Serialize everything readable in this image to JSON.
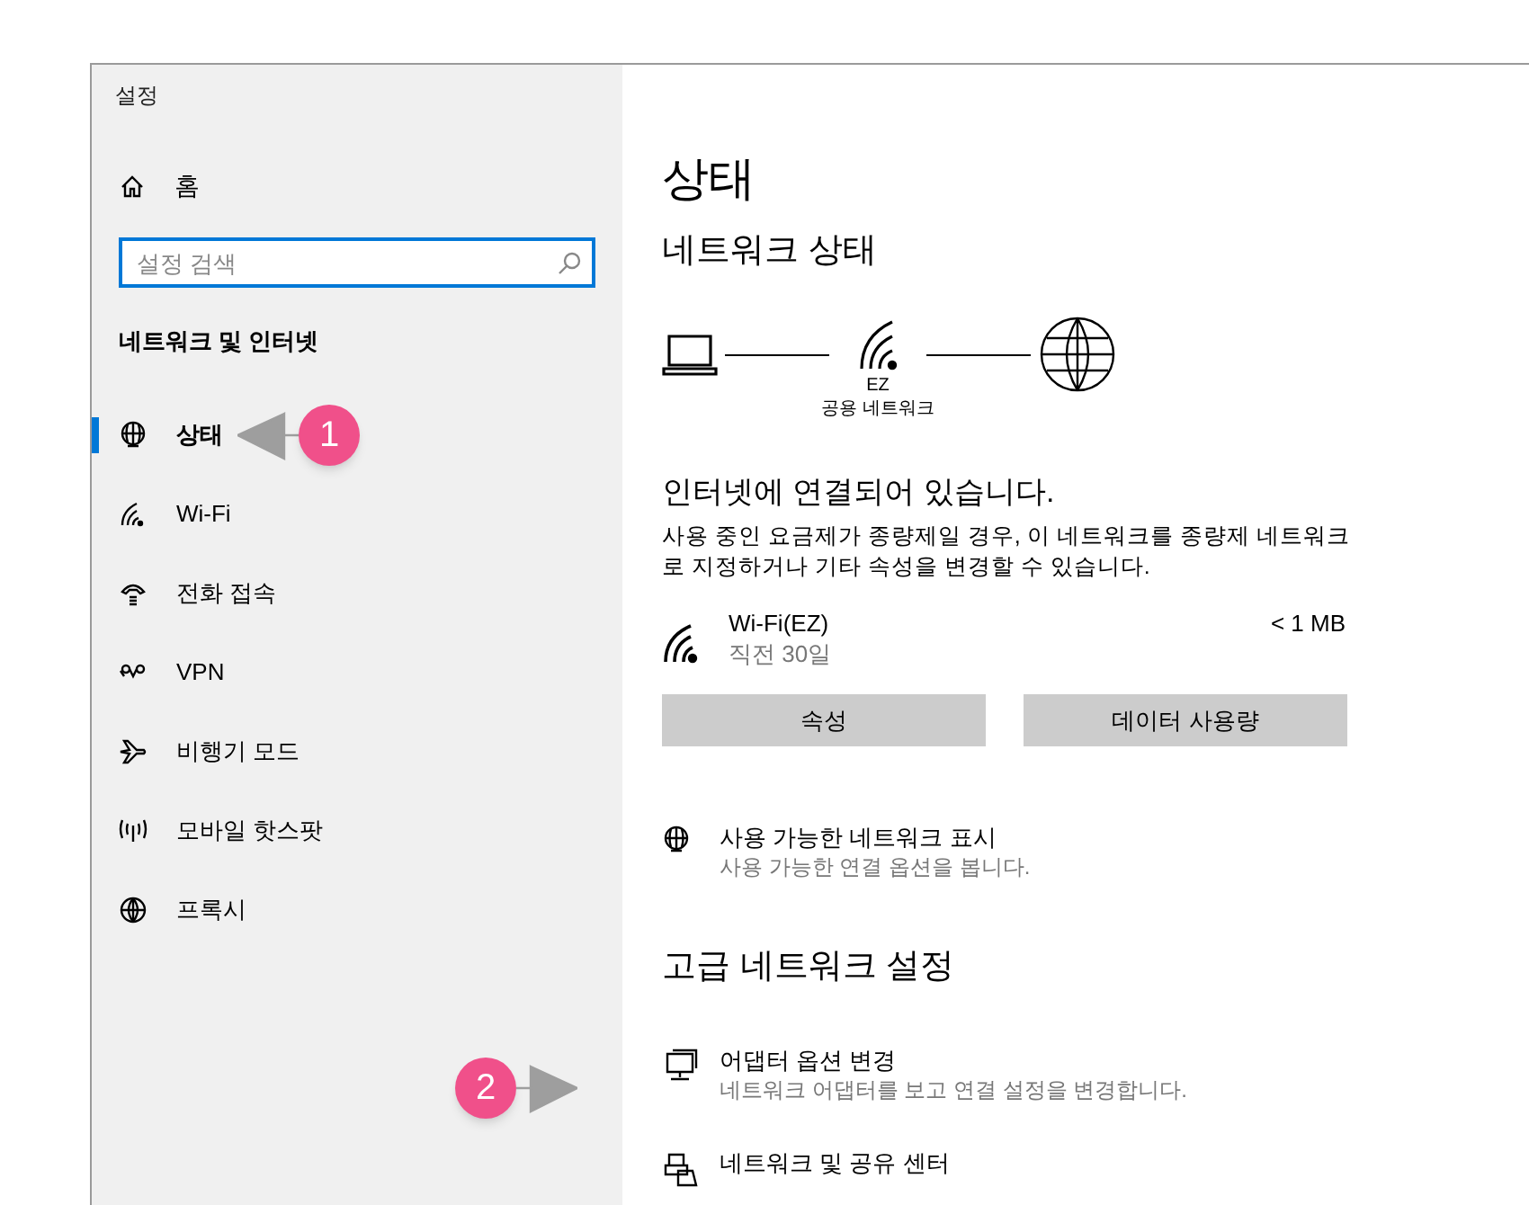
{
  "window": {
    "title": "설정"
  },
  "sidebar": {
    "home": "홈",
    "search": {
      "placeholder": "설정 검색"
    },
    "section_title": "네트워크 및 인터넷",
    "items": [
      {
        "label": "상태",
        "selected": true
      },
      {
        "label": "Wi-Fi",
        "selected": false
      },
      {
        "label": "전화 접속",
        "selected": false
      },
      {
        "label": "VPN",
        "selected": false
      },
      {
        "label": "비행기 모드",
        "selected": false
      },
      {
        "label": "모바일 핫스팟",
        "selected": false
      },
      {
        "label": "프록시",
        "selected": false
      }
    ]
  },
  "content": {
    "title": "상태",
    "network_status": "네트워크 상태",
    "diagram": {
      "network_name": "EZ",
      "network_type": "공용 네트워크"
    },
    "connection_status": "인터넷에 연결되어 있습니다.",
    "description": "사용 중인 요금제가 종량제일 경우, 이 네트워크를 종량제 네트워크로 지정하거나 기타 속성을 변경할 수 있습니다.",
    "connection": {
      "name": "Wi-Fi(EZ)",
      "time": "직전 30일",
      "usage": "< 1 MB"
    },
    "buttons": [
      "속성",
      "데이터 사용량"
    ],
    "links": [
      {
        "title": "사용 가능한 네트워크 표시",
        "description": "사용 가능한 연결 옵션을 봅니다."
      }
    ],
    "advanced_title": "고급 네트워크 설정",
    "advanced": [
      {
        "title": "어댑터 옵션 변경",
        "description": "네트워크 어댑터를 보고 연결 설정을 변경합니다."
      },
      {
        "title": "네트워크 및 공유 센터"
      }
    ]
  },
  "annotations": [
    {
      "number": "1"
    },
    {
      "number": "2"
    }
  ]
}
